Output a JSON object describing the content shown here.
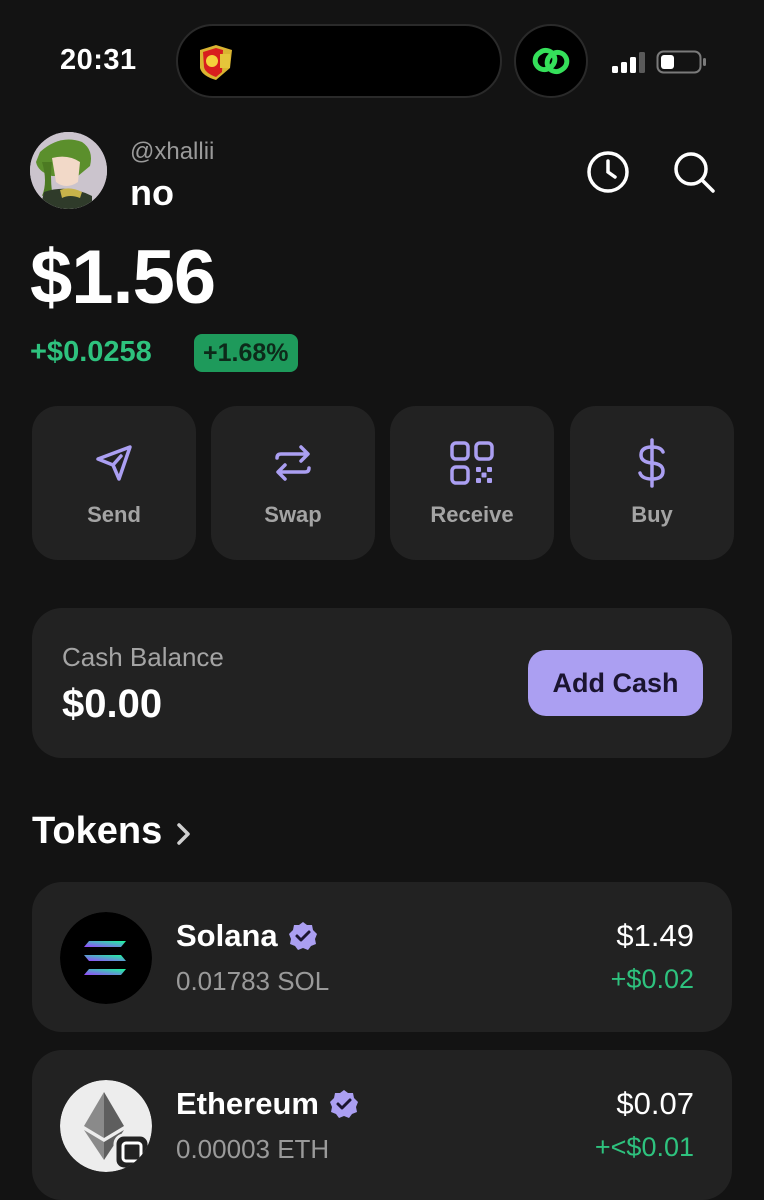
{
  "status_bar": {
    "time": "20:31"
  },
  "profile": {
    "handle": "@xhallii",
    "name": "no"
  },
  "balance": {
    "total": "$1.56",
    "change_amount": "+$0.0258",
    "change_percent": "+1.68%"
  },
  "actions": [
    {
      "label": "Send",
      "icon": "send-icon"
    },
    {
      "label": "Swap",
      "icon": "swap-icon"
    },
    {
      "label": "Receive",
      "icon": "qr-code-icon"
    },
    {
      "label": "Buy",
      "icon": "dollar-icon"
    }
  ],
  "cash": {
    "label": "Cash Balance",
    "value": "$0.00",
    "button": "Add Cash"
  },
  "tokens": {
    "title": "Tokens",
    "items": [
      {
        "name": "Solana",
        "amount": "0.01783 SOL",
        "value": "$1.49",
        "change": "+$0.02",
        "icon": "solana-logo-icon"
      },
      {
        "name": "Ethereum",
        "amount": "0.00003 ETH",
        "value": "$0.07",
        "change": "+<$0.01",
        "icon": "ethereum-logo-icon"
      }
    ]
  },
  "colors": {
    "background": "#131313",
    "card": "#222222",
    "accent": "#ab9ff2",
    "positive": "#2ec27e"
  }
}
